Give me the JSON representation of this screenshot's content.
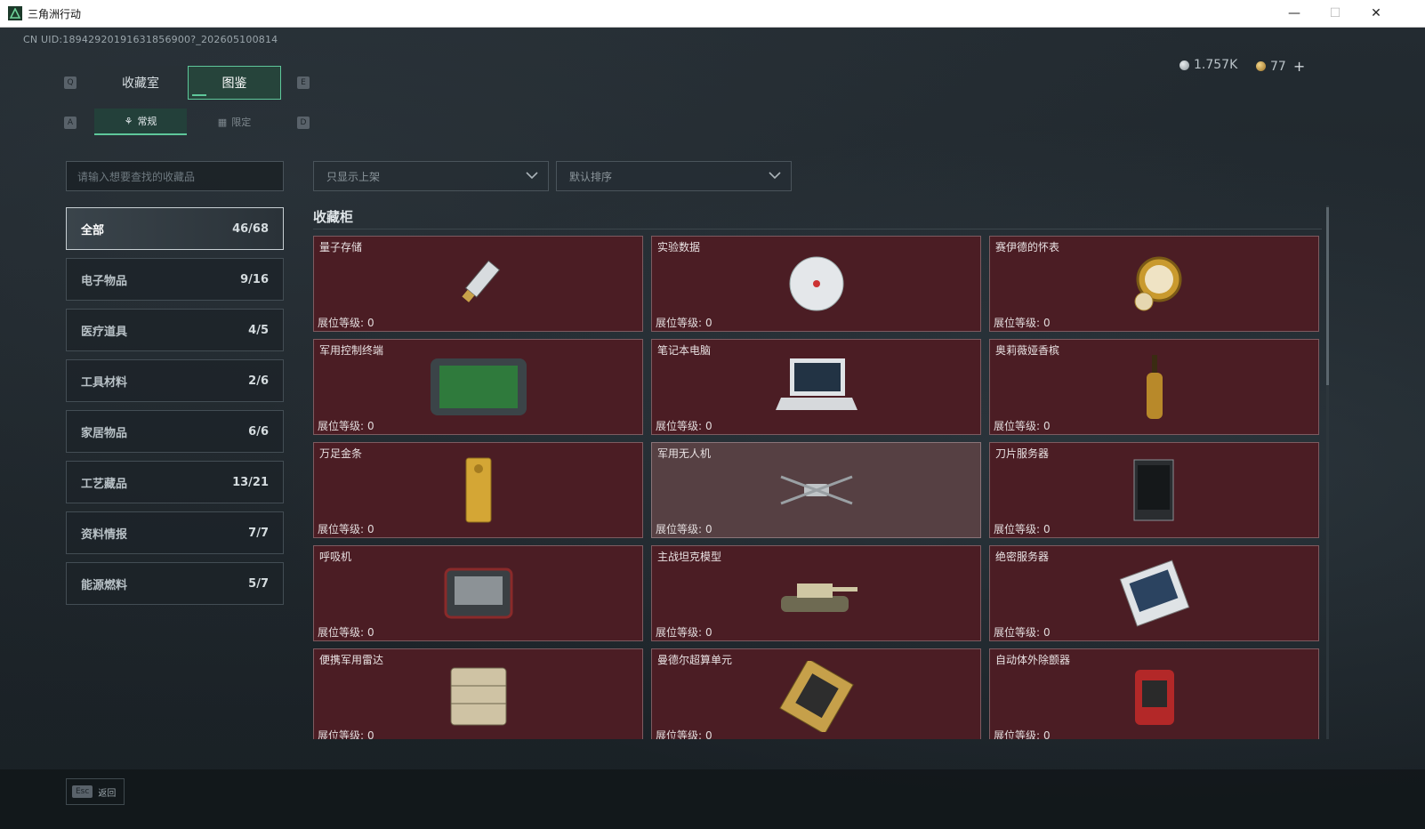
{
  "window": {
    "title": "三角洲行动"
  },
  "header": {
    "uid": "CN UID:18942920191631856900?_202605100814",
    "coins": "1.757K",
    "gems": "77",
    "coins_icon": "silver-coin-icon",
    "gems_icon": "gold-coin-icon"
  },
  "tabs": {
    "left_key": "Q",
    "right_key": "E",
    "items": [
      "收藏室",
      "图鉴"
    ],
    "active": "图鉴"
  },
  "subtabs": {
    "left_key": "A",
    "right_key": "D",
    "items": [
      "常规",
      "限定"
    ],
    "active": "常规"
  },
  "search": {
    "placeholder": "请输入想要查找的收藏品"
  },
  "filters": {
    "shelf_filter": "只显示上架",
    "sort": "默认排序"
  },
  "categories": [
    {
      "label": "全部",
      "count": "46/68"
    },
    {
      "label": "电子物品",
      "count": "9/16"
    },
    {
      "label": "医疗道具",
      "count": "4/5"
    },
    {
      "label": "工具材料",
      "count": "2/6"
    },
    {
      "label": "家居物品",
      "count": "6/6"
    },
    {
      "label": "工艺藏品",
      "count": "13/21"
    },
    {
      "label": "资料情报",
      "count": "7/7"
    },
    {
      "label": "能源燃料",
      "count": "5/7"
    }
  ],
  "section": {
    "title": "收藏柜"
  },
  "level_label": "展位等级:",
  "items": [
    {
      "name": "量子存储",
      "level": "0",
      "icon": "usb-drive-icon"
    },
    {
      "name": "实验数据",
      "level": "0",
      "icon": "disc-icon"
    },
    {
      "name": "赛伊德的怀表",
      "level": "0",
      "icon": "pocket-watch-icon"
    },
    {
      "name": "军用控制终端",
      "level": "0",
      "icon": "control-terminal-icon"
    },
    {
      "name": "笔记本电脑",
      "level": "0",
      "icon": "laptop-icon"
    },
    {
      "name": "奥莉薇娅香槟",
      "level": "0",
      "icon": "champagne-bottle-icon"
    },
    {
      "name": "万足金条",
      "level": "0",
      "icon": "gold-bar-icon"
    },
    {
      "name": "军用无人机",
      "level": "0",
      "icon": "drone-icon"
    },
    {
      "name": "刀片服务器",
      "level": "0",
      "icon": "blade-server-icon"
    },
    {
      "name": "呼吸机",
      "level": "0",
      "icon": "ventilator-icon"
    },
    {
      "name": "主战坦克模型",
      "level": "0",
      "icon": "tank-model-icon"
    },
    {
      "name": "绝密服务器",
      "level": "0",
      "icon": "server-board-icon"
    },
    {
      "name": "便携军用雷达",
      "level": "0",
      "icon": "radar-icon"
    },
    {
      "name": "曼德尔超算单元",
      "level": "0",
      "icon": "supercomputer-unit-icon"
    },
    {
      "name": "自动体外除颤器",
      "level": "0",
      "icon": "defibrillator-icon"
    }
  ],
  "footer": {
    "esc_key": "Esc",
    "back_label": "返回"
  },
  "colors": {
    "card_bg": "#4b1d24",
    "accent": "#5ec79a",
    "panel": "#1e252b"
  }
}
